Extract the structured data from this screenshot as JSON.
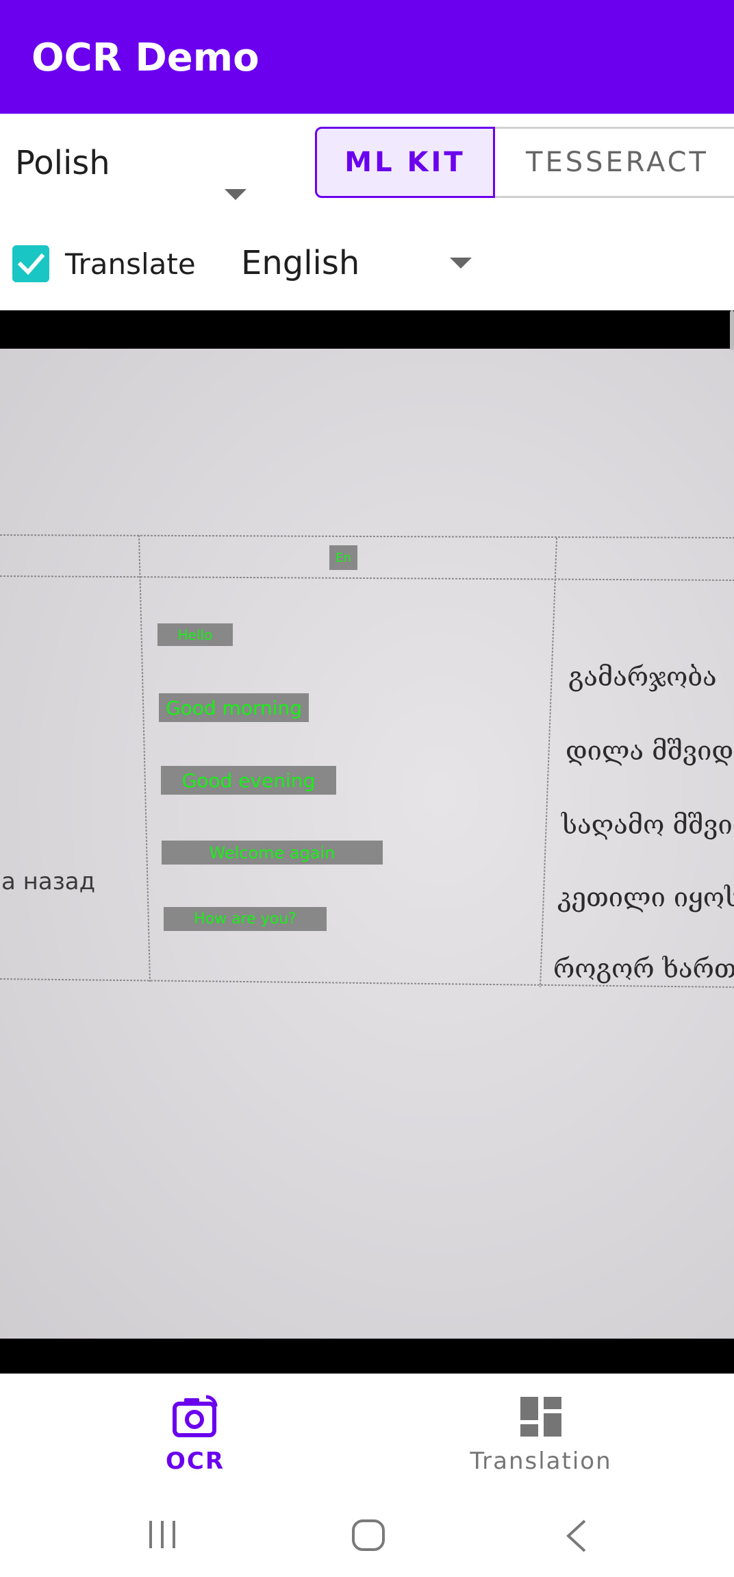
{
  "app": {
    "title": "OCR Demo",
    "accent_color": "#6a00ee"
  },
  "source_language": {
    "selected": "Polish"
  },
  "engine_toggle": {
    "options": [
      "ML KIT",
      "TESSERACT"
    ],
    "selected": "ML KIT"
  },
  "translate": {
    "checked": true,
    "label": "Translate"
  },
  "target_language": {
    "selected": "English"
  },
  "camera_preview": {
    "photo_text": {
      "left_cell_text": "а назад",
      "georgian_column": [
        "გამარჯობა",
        "დილა მშვიდ",
        "საღამო მშვიდ",
        "კეთილი იყოს",
        "როგორ ხართ?"
      ]
    },
    "overlays": [
      "En",
      "Hello",
      "Good morning",
      "Good evening",
      "Welcome again",
      "How are you?"
    ],
    "overlay_text_color": "#17f017"
  },
  "bottom_nav": {
    "items": [
      {
        "label": "OCR",
        "icon": "camera-icon",
        "active": true
      },
      {
        "label": "Translation",
        "icon": "dashboard-icon",
        "active": false
      }
    ]
  },
  "system_nav": {
    "icons": [
      "recents-icon",
      "home-icon",
      "back-icon"
    ]
  }
}
